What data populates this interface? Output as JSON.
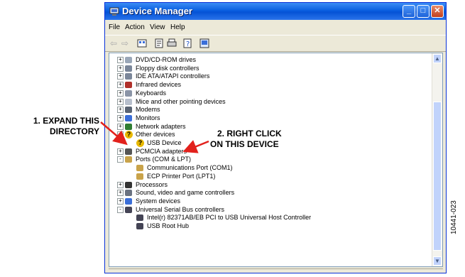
{
  "window": {
    "title": "Device Manager",
    "controls": {
      "minimize": "_",
      "maximize": "□",
      "close": "✕"
    }
  },
  "menu": [
    "File",
    "Action",
    "View",
    "Help"
  ],
  "toolbar_icons": [
    "back-arrow-icon",
    "forward-arrow-icon",
    "view-icon",
    "properties-icon",
    "print-icon",
    "help-icon",
    "scan-hardware-icon"
  ],
  "tree": {
    "items": [
      {
        "label": "DVD/CD-ROM drives",
        "level": 0,
        "expander": "+",
        "icon": "cdrom-icon"
      },
      {
        "label": "Floppy disk controllers",
        "level": 0,
        "expander": "+",
        "icon": "floppy-icon"
      },
      {
        "label": "IDE ATA/ATAPI controllers",
        "level": 0,
        "expander": "+",
        "icon": "ide-icon"
      },
      {
        "label": "Infrared devices",
        "level": 0,
        "expander": "+",
        "icon": "infrared-icon"
      },
      {
        "label": "Keyboards",
        "level": 0,
        "expander": "+",
        "icon": "keyboard-icon"
      },
      {
        "label": "Mice and other pointing devices",
        "level": 0,
        "expander": "+",
        "icon": "mouse-icon"
      },
      {
        "label": "Modems",
        "level": 0,
        "expander": "+",
        "icon": "modem-icon"
      },
      {
        "label": "Monitors",
        "level": 0,
        "expander": "+",
        "icon": "monitor-icon"
      },
      {
        "label": "Network adapters",
        "level": 0,
        "expander": "+",
        "icon": "network-icon"
      },
      {
        "label": "Other devices",
        "level": 0,
        "expander": "-",
        "icon": "unknown-device-icon"
      },
      {
        "label": "USB Device",
        "level": 1,
        "expander": "",
        "icon": "unknown-device-icon"
      },
      {
        "label": "PCMCIA adapters",
        "level": 0,
        "expander": "+",
        "icon": "pcmcia-icon"
      },
      {
        "label": "Ports (COM & LPT)",
        "level": 0,
        "expander": "-",
        "icon": "port-icon"
      },
      {
        "label": "Communications Port (COM1)",
        "level": 1,
        "expander": "",
        "icon": "port-icon"
      },
      {
        "label": "ECP Printer Port (LPT1)",
        "level": 1,
        "expander": "",
        "icon": "port-icon"
      },
      {
        "label": "Processors",
        "level": 0,
        "expander": "+",
        "icon": "processor-icon"
      },
      {
        "label": "Sound, video and game controllers",
        "level": 0,
        "expander": "+",
        "icon": "sound-icon"
      },
      {
        "label": "System devices",
        "level": 0,
        "expander": "+",
        "icon": "system-icon"
      },
      {
        "label": "Universal Serial Bus controllers",
        "level": 0,
        "expander": "-",
        "icon": "usb-icon"
      },
      {
        "label": "Intel(r) 82371AB/EB PCI to USB Universal Host Controller",
        "level": 1,
        "expander": "",
        "icon": "usb-icon"
      },
      {
        "label": "USB Root Hub",
        "level": 1,
        "expander": "",
        "icon": "usb-icon"
      }
    ]
  },
  "scrollbar": {
    "up": "▲",
    "down": "▼"
  },
  "callouts": {
    "expand": [
      "1. EXPAND THIS",
      "DIRECTORY"
    ],
    "right_click": [
      "2. RIGHT CLICK",
      "ON THIS DEVICE"
    ]
  },
  "figure_id": "10441-023",
  "colors": {
    "titlebar": "#0553d6",
    "arrow": "#e2211c",
    "frame": "#ece9d8"
  }
}
